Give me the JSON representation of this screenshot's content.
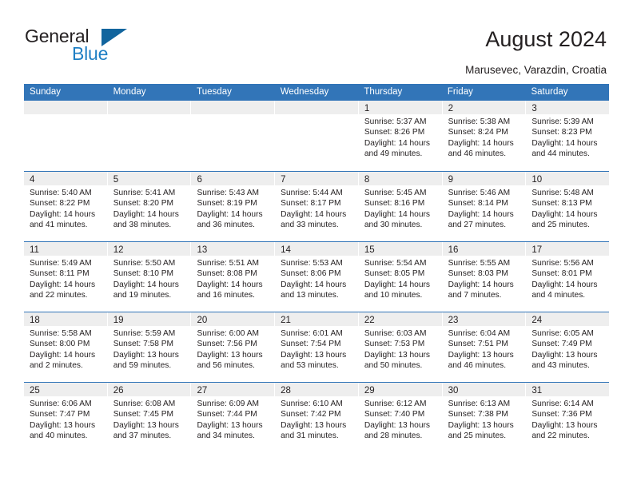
{
  "brand": {
    "name_top": "General",
    "name_bottom": "Blue",
    "triangle_color": "#12659e",
    "blue_color": "#1f7fc4"
  },
  "header": {
    "title": "August 2024",
    "subtitle": "Marusevec, Varazdin, Croatia"
  },
  "theme": {
    "header_blue": "#3275b8",
    "daynum_band": "#eeeeee",
    "text": "#231f20"
  },
  "calendar": {
    "weekdays": [
      "Sunday",
      "Monday",
      "Tuesday",
      "Wednesday",
      "Thursday",
      "Friday",
      "Saturday"
    ],
    "weeks": [
      [
        {
          "day": "",
          "empty": true,
          "l1": "",
          "l2": "",
          "l3": "",
          "l4": ""
        },
        {
          "day": "",
          "empty": true,
          "l1": "",
          "l2": "",
          "l3": "",
          "l4": ""
        },
        {
          "day": "",
          "empty": true,
          "l1": "",
          "l2": "",
          "l3": "",
          "l4": ""
        },
        {
          "day": "",
          "empty": true,
          "l1": "",
          "l2": "",
          "l3": "",
          "l4": ""
        },
        {
          "day": "1",
          "empty": false,
          "l1": "Sunrise: 5:37 AM",
          "l2": "Sunset: 8:26 PM",
          "l3": "Daylight: 14 hours",
          "l4": "and 49 minutes."
        },
        {
          "day": "2",
          "empty": false,
          "l1": "Sunrise: 5:38 AM",
          "l2": "Sunset: 8:24 PM",
          "l3": "Daylight: 14 hours",
          "l4": "and 46 minutes."
        },
        {
          "day": "3",
          "empty": false,
          "l1": "Sunrise: 5:39 AM",
          "l2": "Sunset: 8:23 PM",
          "l3": "Daylight: 14 hours",
          "l4": "and 44 minutes."
        }
      ],
      [
        {
          "day": "4",
          "empty": false,
          "l1": "Sunrise: 5:40 AM",
          "l2": "Sunset: 8:22 PM",
          "l3": "Daylight: 14 hours",
          "l4": "and 41 minutes."
        },
        {
          "day": "5",
          "empty": false,
          "l1": "Sunrise: 5:41 AM",
          "l2": "Sunset: 8:20 PM",
          "l3": "Daylight: 14 hours",
          "l4": "and 38 minutes."
        },
        {
          "day": "6",
          "empty": false,
          "l1": "Sunrise: 5:43 AM",
          "l2": "Sunset: 8:19 PM",
          "l3": "Daylight: 14 hours",
          "l4": "and 36 minutes."
        },
        {
          "day": "7",
          "empty": false,
          "l1": "Sunrise: 5:44 AM",
          "l2": "Sunset: 8:17 PM",
          "l3": "Daylight: 14 hours",
          "l4": "and 33 minutes."
        },
        {
          "day": "8",
          "empty": false,
          "l1": "Sunrise: 5:45 AM",
          "l2": "Sunset: 8:16 PM",
          "l3": "Daylight: 14 hours",
          "l4": "and 30 minutes."
        },
        {
          "day": "9",
          "empty": false,
          "l1": "Sunrise: 5:46 AM",
          "l2": "Sunset: 8:14 PM",
          "l3": "Daylight: 14 hours",
          "l4": "and 27 minutes."
        },
        {
          "day": "10",
          "empty": false,
          "l1": "Sunrise: 5:48 AM",
          "l2": "Sunset: 8:13 PM",
          "l3": "Daylight: 14 hours",
          "l4": "and 25 minutes."
        }
      ],
      [
        {
          "day": "11",
          "empty": false,
          "l1": "Sunrise: 5:49 AM",
          "l2": "Sunset: 8:11 PM",
          "l3": "Daylight: 14 hours",
          "l4": "and 22 minutes."
        },
        {
          "day": "12",
          "empty": false,
          "l1": "Sunrise: 5:50 AM",
          "l2": "Sunset: 8:10 PM",
          "l3": "Daylight: 14 hours",
          "l4": "and 19 minutes."
        },
        {
          "day": "13",
          "empty": false,
          "l1": "Sunrise: 5:51 AM",
          "l2": "Sunset: 8:08 PM",
          "l3": "Daylight: 14 hours",
          "l4": "and 16 minutes."
        },
        {
          "day": "14",
          "empty": false,
          "l1": "Sunrise: 5:53 AM",
          "l2": "Sunset: 8:06 PM",
          "l3": "Daylight: 14 hours",
          "l4": "and 13 minutes."
        },
        {
          "day": "15",
          "empty": false,
          "l1": "Sunrise: 5:54 AM",
          "l2": "Sunset: 8:05 PM",
          "l3": "Daylight: 14 hours",
          "l4": "and 10 minutes."
        },
        {
          "day": "16",
          "empty": false,
          "l1": "Sunrise: 5:55 AM",
          "l2": "Sunset: 8:03 PM",
          "l3": "Daylight: 14 hours",
          "l4": "and 7 minutes."
        },
        {
          "day": "17",
          "empty": false,
          "l1": "Sunrise: 5:56 AM",
          "l2": "Sunset: 8:01 PM",
          "l3": "Daylight: 14 hours",
          "l4": "and 4 minutes."
        }
      ],
      [
        {
          "day": "18",
          "empty": false,
          "l1": "Sunrise: 5:58 AM",
          "l2": "Sunset: 8:00 PM",
          "l3": "Daylight: 14 hours",
          "l4": "and 2 minutes."
        },
        {
          "day": "19",
          "empty": false,
          "l1": "Sunrise: 5:59 AM",
          "l2": "Sunset: 7:58 PM",
          "l3": "Daylight: 13 hours",
          "l4": "and 59 minutes."
        },
        {
          "day": "20",
          "empty": false,
          "l1": "Sunrise: 6:00 AM",
          "l2": "Sunset: 7:56 PM",
          "l3": "Daylight: 13 hours",
          "l4": "and 56 minutes."
        },
        {
          "day": "21",
          "empty": false,
          "l1": "Sunrise: 6:01 AM",
          "l2": "Sunset: 7:54 PM",
          "l3": "Daylight: 13 hours",
          "l4": "and 53 minutes."
        },
        {
          "day": "22",
          "empty": false,
          "l1": "Sunrise: 6:03 AM",
          "l2": "Sunset: 7:53 PM",
          "l3": "Daylight: 13 hours",
          "l4": "and 50 minutes."
        },
        {
          "day": "23",
          "empty": false,
          "l1": "Sunrise: 6:04 AM",
          "l2": "Sunset: 7:51 PM",
          "l3": "Daylight: 13 hours",
          "l4": "and 46 minutes."
        },
        {
          "day": "24",
          "empty": false,
          "l1": "Sunrise: 6:05 AM",
          "l2": "Sunset: 7:49 PM",
          "l3": "Daylight: 13 hours",
          "l4": "and 43 minutes."
        }
      ],
      [
        {
          "day": "25",
          "empty": false,
          "l1": "Sunrise: 6:06 AM",
          "l2": "Sunset: 7:47 PM",
          "l3": "Daylight: 13 hours",
          "l4": "and 40 minutes."
        },
        {
          "day": "26",
          "empty": false,
          "l1": "Sunrise: 6:08 AM",
          "l2": "Sunset: 7:45 PM",
          "l3": "Daylight: 13 hours",
          "l4": "and 37 minutes."
        },
        {
          "day": "27",
          "empty": false,
          "l1": "Sunrise: 6:09 AM",
          "l2": "Sunset: 7:44 PM",
          "l3": "Daylight: 13 hours",
          "l4": "and 34 minutes."
        },
        {
          "day": "28",
          "empty": false,
          "l1": "Sunrise: 6:10 AM",
          "l2": "Sunset: 7:42 PM",
          "l3": "Daylight: 13 hours",
          "l4": "and 31 minutes."
        },
        {
          "day": "29",
          "empty": false,
          "l1": "Sunrise: 6:12 AM",
          "l2": "Sunset: 7:40 PM",
          "l3": "Daylight: 13 hours",
          "l4": "and 28 minutes."
        },
        {
          "day": "30",
          "empty": false,
          "l1": "Sunrise: 6:13 AM",
          "l2": "Sunset: 7:38 PM",
          "l3": "Daylight: 13 hours",
          "l4": "and 25 minutes."
        },
        {
          "day": "31",
          "empty": false,
          "l1": "Sunrise: 6:14 AM",
          "l2": "Sunset: 7:36 PM",
          "l3": "Daylight: 13 hours",
          "l4": "and 22 minutes."
        }
      ]
    ]
  }
}
